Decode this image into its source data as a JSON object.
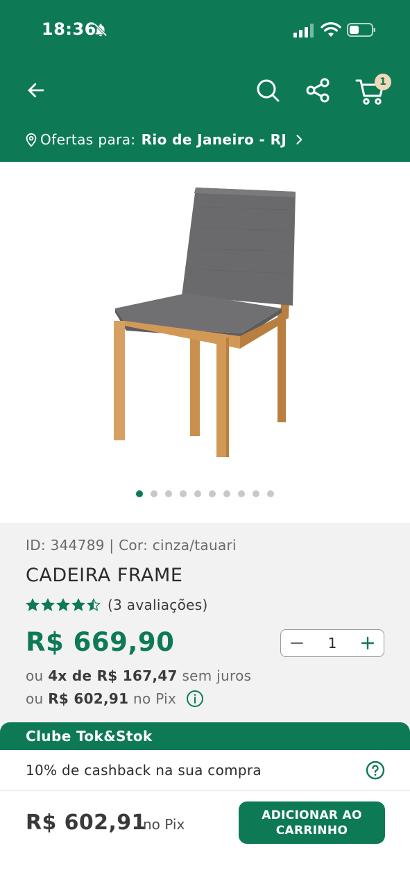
{
  "status_bar": {
    "time": "18:36",
    "icons": [
      "bell-slash-icon",
      "cellular-signal-icon",
      "wifi-icon",
      "battery-icon"
    ]
  },
  "nav": {
    "icons": [
      "arrow-left-icon",
      "search-icon",
      "share-icon",
      "cart-icon"
    ],
    "cart_count": "1"
  },
  "location": {
    "label": "Ofertas para:",
    "city": "Rio de Janeiro - RJ"
  },
  "gallery": {
    "image": "product-chair-image",
    "dot_count": 10,
    "active_index": 0
  },
  "product": {
    "meta": "ID: 344789 | Cor: cinza/tauari",
    "title": "CADEIRA FRAME",
    "rating": 4.5,
    "reviews": "(3 avaliações)",
    "price": "R$ 669,90",
    "installments_prefix": "ou",
    "installments_bold": "4x de R$ 167,47",
    "installments_suffix": "sem juros",
    "pix_prefix": "ou",
    "pix_bold": "R$ 602,91",
    "pix_suffix": "no Pix"
  },
  "quantity": {
    "value": "1"
  },
  "clube": {
    "title": "Clube Tok&Stok",
    "text": "10% de cashback na sua compra"
  },
  "bottom_bar": {
    "price": "R$ 602,91",
    "price_suffix": "no Pix",
    "button_label": "ADICIONAR AO CARRINHO"
  },
  "colors": {
    "brand_green": "#0e7a55",
    "badge": "#f0d8b8"
  }
}
